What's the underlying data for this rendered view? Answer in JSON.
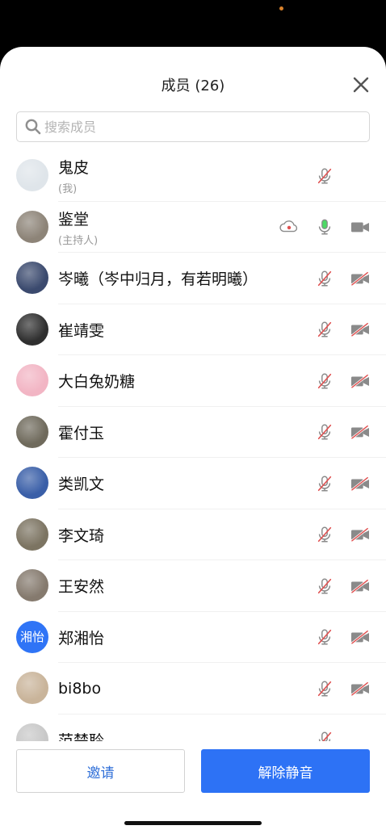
{
  "header": {
    "title": "成员 (26)"
  },
  "search": {
    "placeholder": "搜索成员"
  },
  "members": [
    {
      "name": "鬼皮",
      "role": "(我)",
      "mic": "muted",
      "cam": "none",
      "avatar_color": "#dfe5ea"
    },
    {
      "name": "鉴堂",
      "role": "(主持人)",
      "mic": "active",
      "cam": "on",
      "recording": true,
      "avatar_color": "#8d8478"
    },
    {
      "name": "岑曦（岑中归月，有若明曦）",
      "role": "",
      "mic": "muted",
      "cam": "off",
      "avatar_color": "#3b4a6e"
    },
    {
      "name": "崔靖雯",
      "role": "",
      "mic": "muted",
      "cam": "off",
      "avatar_color": "#2f2f2f"
    },
    {
      "name": "大白兔奶糖",
      "role": "",
      "mic": "muted",
      "cam": "off",
      "avatar_color": "#f2b5c4"
    },
    {
      "name": "霍付玉",
      "role": "",
      "mic": "muted",
      "cam": "off",
      "avatar_color": "#6f6a5c"
    },
    {
      "name": "类凯文",
      "role": "",
      "mic": "muted",
      "cam": "off",
      "avatar_color": "#3a5fa8"
    },
    {
      "name": "李文琦",
      "role": "",
      "mic": "muted",
      "cam": "off",
      "avatar_color": "#7c7462"
    },
    {
      "name": "王安然",
      "role": "",
      "mic": "muted",
      "cam": "off",
      "avatar_color": "#857a6e"
    },
    {
      "name": "郑湘怡",
      "role": "",
      "mic": "muted",
      "cam": "off",
      "avatar_text": "湘怡",
      "avatar_color": "#2f74f6"
    },
    {
      "name": "bi8bo",
      "role": "",
      "mic": "muted",
      "cam": "off",
      "avatar_color": "#c9b49a"
    },
    {
      "name": "范楚聆",
      "role": "",
      "mic": "muted",
      "cam": "none",
      "avatar_color": "#c8c8c8"
    }
  ],
  "footer": {
    "invite_label": "邀请",
    "unmute_label": "解除静音"
  },
  "colors": {
    "accent": "#2d72f5",
    "muted_red": "#e05252",
    "mic_active": "#4cd964",
    "icon_gray": "#8a8a8a"
  }
}
